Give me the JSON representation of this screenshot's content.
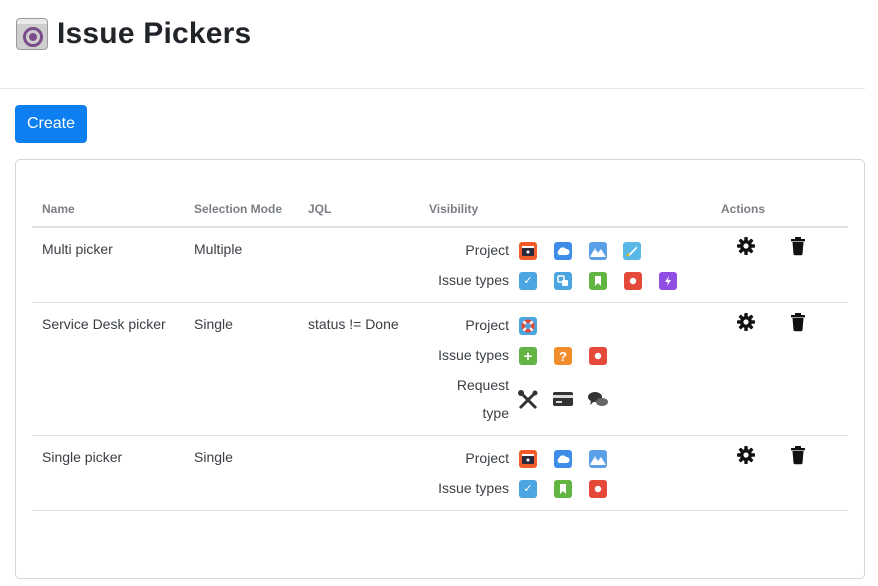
{
  "header": {
    "title": "Issue Pickers",
    "logo_icon": "issue-pickers-app-icon"
  },
  "toolbar": {
    "create_label": "Create",
    "accent": "#0d7ff0"
  },
  "table": {
    "columns": [
      "Name",
      "Selection Mode",
      "JQL",
      "Visibility",
      "Actions"
    ],
    "rows": [
      {
        "name": "Multi picker",
        "mode": "Multiple",
        "jql": "",
        "visibility": {
          "project_label": "Project",
          "project_icons": [
            "project-dev-icon",
            "project-cloud-icon",
            "project-mountain-icon",
            "project-rocket-icon"
          ],
          "issue_types_label": "Issue types",
          "issue_type_icons": [
            "task-check-icon",
            "subtask-icon",
            "story-bookmark-icon",
            "bug-icon",
            "epic-lightning-icon"
          ]
        }
      },
      {
        "name": "Service Desk picker",
        "mode": "Single",
        "jql": "status != Done",
        "visibility": {
          "project_label": "Project",
          "project_icons": [
            "project-lifebuoy-icon"
          ],
          "issue_types_label": "Issue types",
          "issue_type_icons": [
            "new-feature-plus-icon",
            "question-icon",
            "bug-icon"
          ],
          "request_type_label_1": "Request",
          "request_type_label_2": "type",
          "request_type_icons": [
            "tools-icon",
            "credit-card-icon",
            "chat-bubbles-icon"
          ]
        }
      },
      {
        "name": "Single picker",
        "mode": "Single",
        "jql": "",
        "visibility": {
          "project_label": "Project",
          "project_icons": [
            "project-dev-icon",
            "project-cloud-icon",
            "project-mountain-icon"
          ],
          "issue_types_label": "Issue types",
          "issue_type_icons": [
            "task-check-icon",
            "story-bookmark-icon",
            "bug-icon"
          ]
        }
      }
    ],
    "action_icons": [
      "gear-icon",
      "trash-icon"
    ]
  }
}
